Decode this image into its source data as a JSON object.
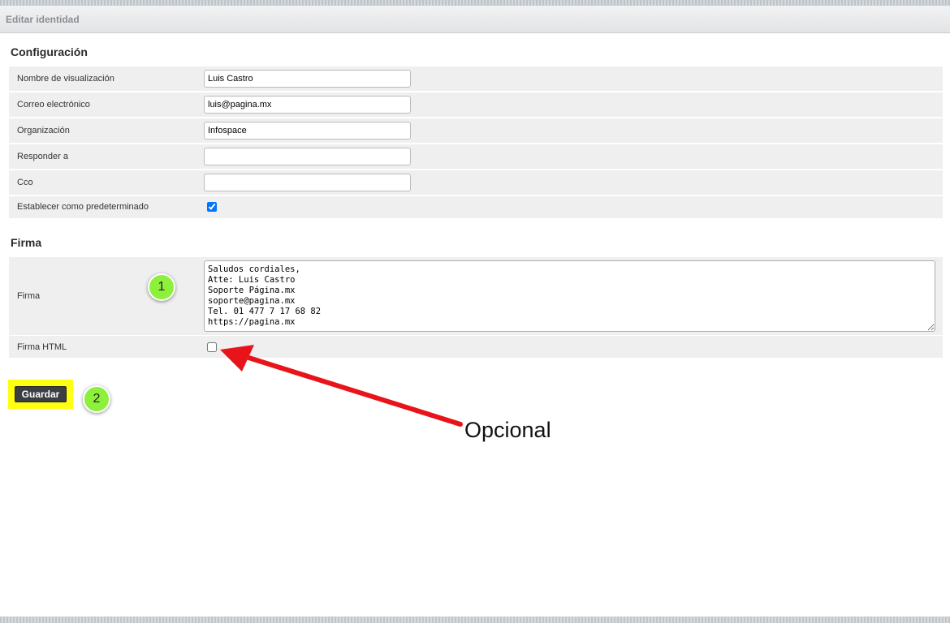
{
  "window": {
    "title": "Editar identidad"
  },
  "settings": {
    "title": "Configuración",
    "display_name_label": "Nombre de visualización",
    "display_name_value": "Luis Castro",
    "email_label": "Correo electrónico",
    "email_value": "luis@pagina.mx",
    "organization_label": "Organización",
    "organization_value": "Infospace",
    "reply_to_label": "Responder a",
    "reply_to_value": "",
    "bcc_label": "Cco",
    "bcc_value": "",
    "default_label": "Establecer como predeterminado",
    "default_checked": true
  },
  "signature": {
    "title": "Firma",
    "label": "Firma",
    "text": "Saludos cordiales,\nAtte: Luis Castro\nSoporte Página.mx\nsoporte@pagina.mx\nTel. 01 477 7 17 68 82\nhttps://pagina.mx",
    "html_label": "Firma HTML",
    "html_checked": false
  },
  "actions": {
    "save_label": "Guardar"
  },
  "annotations": {
    "badge_1": "1",
    "badge_2": "2",
    "optional_note": "Opcional",
    "arrow_color": "#e8141a",
    "badge_color": "#8df03a",
    "highlight_color": "#ffff12"
  }
}
